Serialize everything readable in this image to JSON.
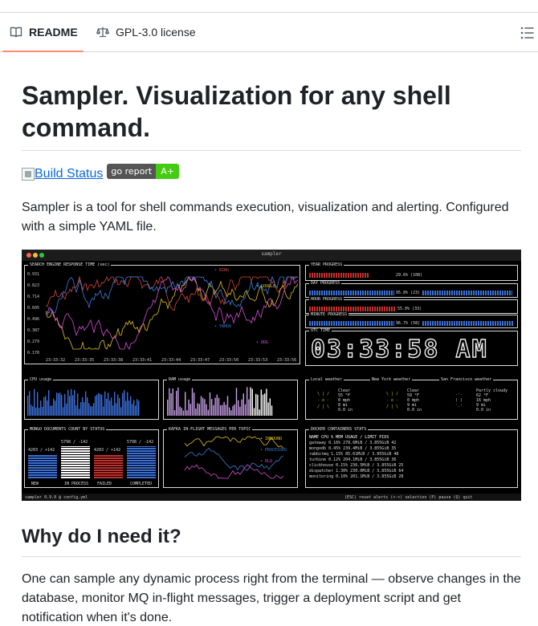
{
  "tabs": {
    "readme": "README",
    "license": "GPL-3.0 license"
  },
  "heading": "Sampler. Visualization for any shell command.",
  "badges": {
    "build_alt": "Build Status",
    "goreport_left": "go report",
    "goreport_right": "A+"
  },
  "description": "Sampler is a tool for shell commands execution, visualization and alerting. Configured with a simple YAML file.",
  "screenshot": {
    "window_title": "sampler",
    "panes": {
      "search": "SEARCH ENGINE RESPONSE TIME (sec)",
      "year": "YEAR PROGRESS",
      "day": "DAY PROGRESS",
      "hour": "HOUR PROGRESS",
      "minute": "MINUTE PROGRESS",
      "utc": "UTC TIME",
      "cpu": "CPU usage",
      "ram": "RAM usage",
      "local_weather": "Local weather",
      "ny_weather": "New York weather",
      "sf_weather": "San Francisco weather",
      "mongo": "MONGO DOCUMENTS COUNT BY STATUS",
      "kafka": "KAFKA IN-FLIGHT MESSAGES PER TOPIC",
      "docker": "DOCKER CONTAINERS STATS"
    },
    "year_value": "29.6% (108)",
    "day_value": "95.8% (23)",
    "hour_value": "55.0% (33)",
    "minute_value": "96.7% (58)",
    "clock": "03:33:58 AM",
    "y_ticks": [
      "0.931",
      "0.823",
      "0.714",
      "0.605",
      "0.496",
      "0.387",
      "0.279",
      "0.170"
    ],
    "x_ticks": [
      "23:33:32",
      "23:33:35",
      "23:33:38",
      "23:33:41",
      "23:33:44",
      "23:33:47",
      "23:33:50",
      "23:33:53",
      "23:33:56"
    ],
    "legend": [
      "BING",
      "GOOGLE",
      "YAHOO",
      "DDG"
    ],
    "mongo_labels": [
      "NEW",
      "IN PROCESS",
      "FAILED",
      "COMPLETED"
    ],
    "mongo_values": [
      "4203 / +142",
      "5798 / -142",
      "4203 / +142",
      "5798 / -142"
    ],
    "kafka_legend": [
      "INBOUND",
      "PROCESSED",
      "DLQ"
    ],
    "docker_header": "NAME            CPU %   MEM USAGE / LIMIT   PIDS",
    "docker_rows": [
      "gateway         0.16%   278.6MiB / 3.855GiB   42",
      "mongodb         0.45%   239.4MiB / 3.855GiB   35",
      "rabbitmq        1.15%   85.61MiB / 3.855GiB   48",
      "turbine         0.12%   204.1MiB / 3.855GiB   36",
      "clickhouse      0.15%   236.5MiB / 3.855GiB   25",
      "dispatcher      1.30%   230.0MiB / 3.855GiB   64",
      "monitoring      0.10%   201.1MiB / 3.855GiB   28"
    ],
    "weather": [
      {
        "cond": "Clear",
        "temp": "55 °F",
        "wind": "0 mph",
        "vis": "8 mi",
        "rain": "0.0 in"
      },
      {
        "cond": "Clear",
        "temp": "59 °F",
        "wind": "0 mph",
        "vis": "9 mi",
        "rain": "0.0 in"
      },
      {
        "cond": "Partly cloudy",
        "temp": "62 °F",
        "wind": "16 mph",
        "vis": "9 mi",
        "rain": "0.0 in"
      }
    ],
    "status_left": "sampler 0.9.0 @ config.yml",
    "status_right": "(ESC) reset alerts   (<->) selection   (P) pause   (Q) quit"
  },
  "section_heading": "Why do I need it?",
  "why_text": "One can sample any dynamic process right from the terminal — observe changes in the database, monitor MQ in-flight messages, trigger a deployment script and get notification when it's done."
}
